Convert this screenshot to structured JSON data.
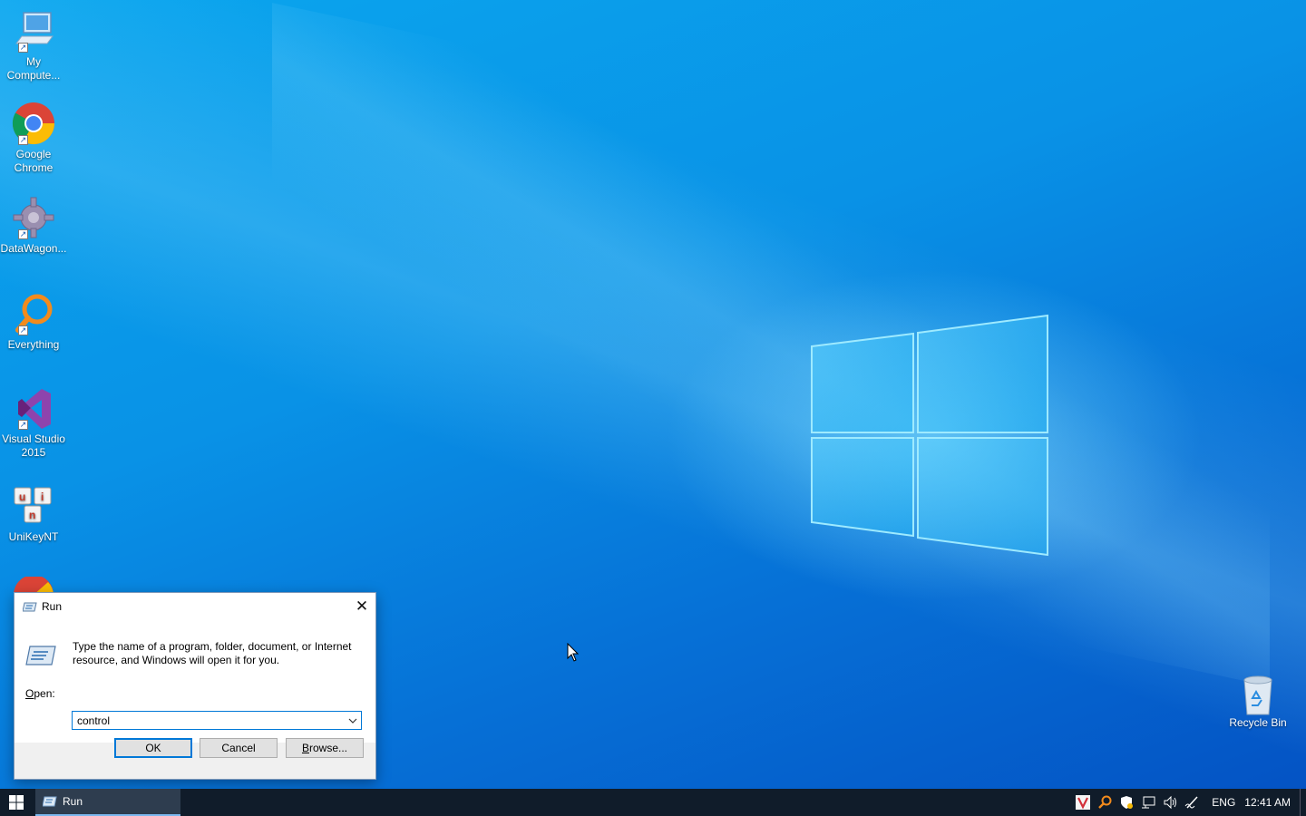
{
  "desktop": {
    "icons": [
      {
        "label": "My\nCompute...",
        "name": "My Computer"
      },
      {
        "label": "Google\nChrome",
        "name": "Google Chrome"
      },
      {
        "label": "DataWagon...",
        "name": "DataWagon"
      },
      {
        "label": "Everything",
        "name": "Everything"
      },
      {
        "label": "Visual Studio\n2015",
        "name": "Visual Studio 2015"
      },
      {
        "label": "UniKeyNT",
        "name": "UniKeyNT"
      }
    ],
    "recycle_bin_label": "Recycle Bin"
  },
  "run_dialog": {
    "title": "Run",
    "close_glyph": "✕",
    "prompt": "Type the name of a program, folder, document, or Internet resource, and Windows will open it for you.",
    "open_label_prefix": "O",
    "open_label_rest": "pen:",
    "open_value": "control",
    "ok_label": "OK",
    "cancel_label": "Cancel",
    "browse_label_prefix": "B",
    "browse_label_rest": "rowse..."
  },
  "taskbar": {
    "run_task_label": "Run",
    "language": "ENG",
    "time": "12:41 AM",
    "tray_icons": [
      "vivaldi-icon",
      "search-everything-icon",
      "security-shield-icon",
      "network-icon",
      "volume-icon",
      "pen-icon"
    ]
  },
  "colors": {
    "accent": "#0078d7",
    "taskbar": "#101c2a",
    "desktop": "#0992e6"
  }
}
